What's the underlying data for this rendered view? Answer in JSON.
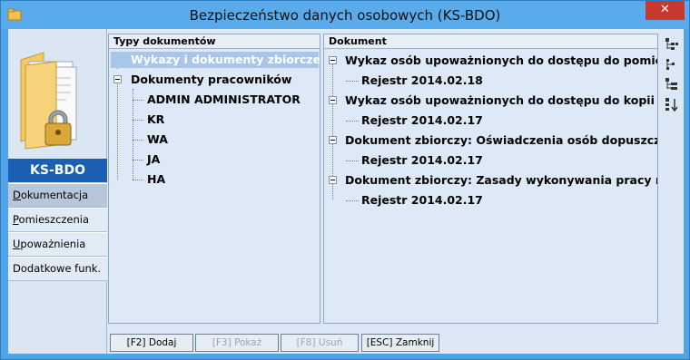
{
  "window": {
    "title": "Bezpieczeństwo danych osobowych (KS-BDO)",
    "close_glyph": "✕"
  },
  "nav": {
    "brand": "KS-BDO",
    "items": [
      {
        "underline": "D",
        "rest": "okumentacja",
        "active": true
      },
      {
        "underline": "P",
        "rest": "omieszczenia",
        "active": false
      },
      {
        "underline": "U",
        "rest": "poważnienia",
        "active": false
      },
      {
        "underline": "",
        "rest": "Dodatkowe funk.",
        "active": false
      }
    ]
  },
  "types_pane": {
    "header": "Typy dokumentów",
    "rows": [
      "Wykazy i dokumenty zbiorcze",
      "Dokumenty pracowników",
      "ADMIN ADMINISTRATOR",
      "KR",
      "WA",
      "JA",
      "HA"
    ]
  },
  "docs_pane": {
    "header": "Dokument",
    "rows": [
      "Wykaz osób upoważnionych do dostępu do pomies...",
      "Rejestr 2014.02.18",
      "Wykaz osób upoważnionych do dostępu do kopii z...",
      "Rejestr 2014.02.17",
      "Dokument zbiorczy: Oświadczenia osób dopuszcz...",
      "Rejestr 2014.02.17",
      "Dokument zbiorczy: Zasady wykonywania pracy n...",
      "Rejestr 2014.02.17"
    ]
  },
  "buttons": [
    {
      "label": "[F2] Dodaj",
      "enabled": true
    },
    {
      "label": "[F3] Pokaż",
      "enabled": false
    },
    {
      "label": "[F8] Usuń",
      "enabled": false
    },
    {
      "label": "[ESC] Zamknij",
      "enabled": true
    }
  ],
  "colors": {
    "accent": "#1a5fb4",
    "title_bar": "#5aabeb",
    "close": "#c7392c"
  },
  "icons": [
    "app-icon",
    "folder-lock-logo",
    "expand-all-icon",
    "collapse-all-icon",
    "tree-view-icon",
    "sort-icon"
  ]
}
